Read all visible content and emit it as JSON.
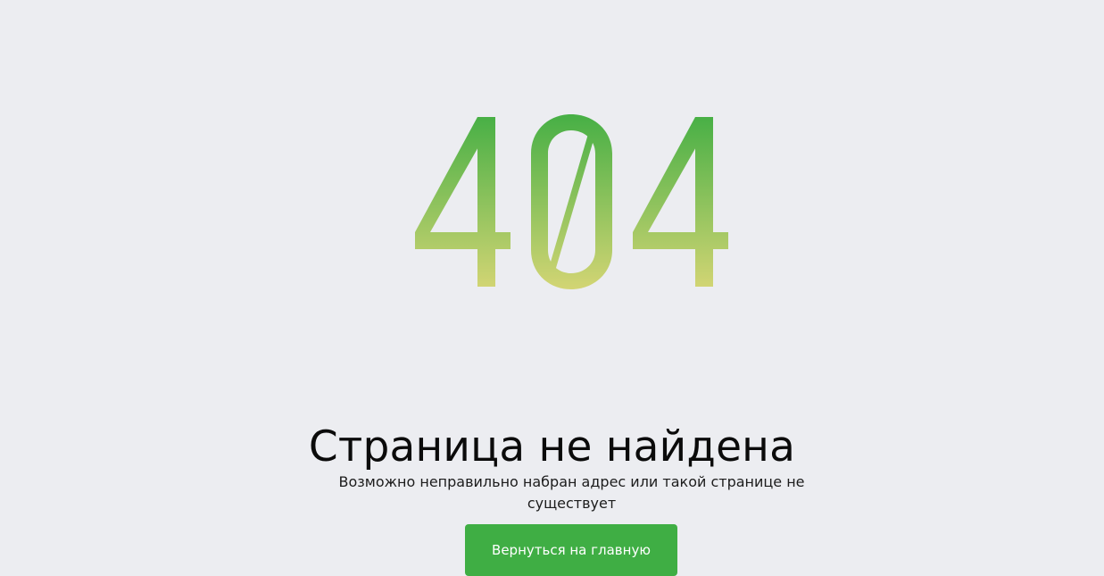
{
  "error": {
    "code": "404",
    "gradient_top_color": "#46af45",
    "gradient_bottom_color": "#d3d574"
  },
  "content": {
    "title": "Страница не найдена",
    "subtitle": "Возможно неправильно набран адрес или такой странице не существует"
  },
  "actions": {
    "home_label": "Вернуться на главную",
    "button_color": "#3fae44"
  }
}
